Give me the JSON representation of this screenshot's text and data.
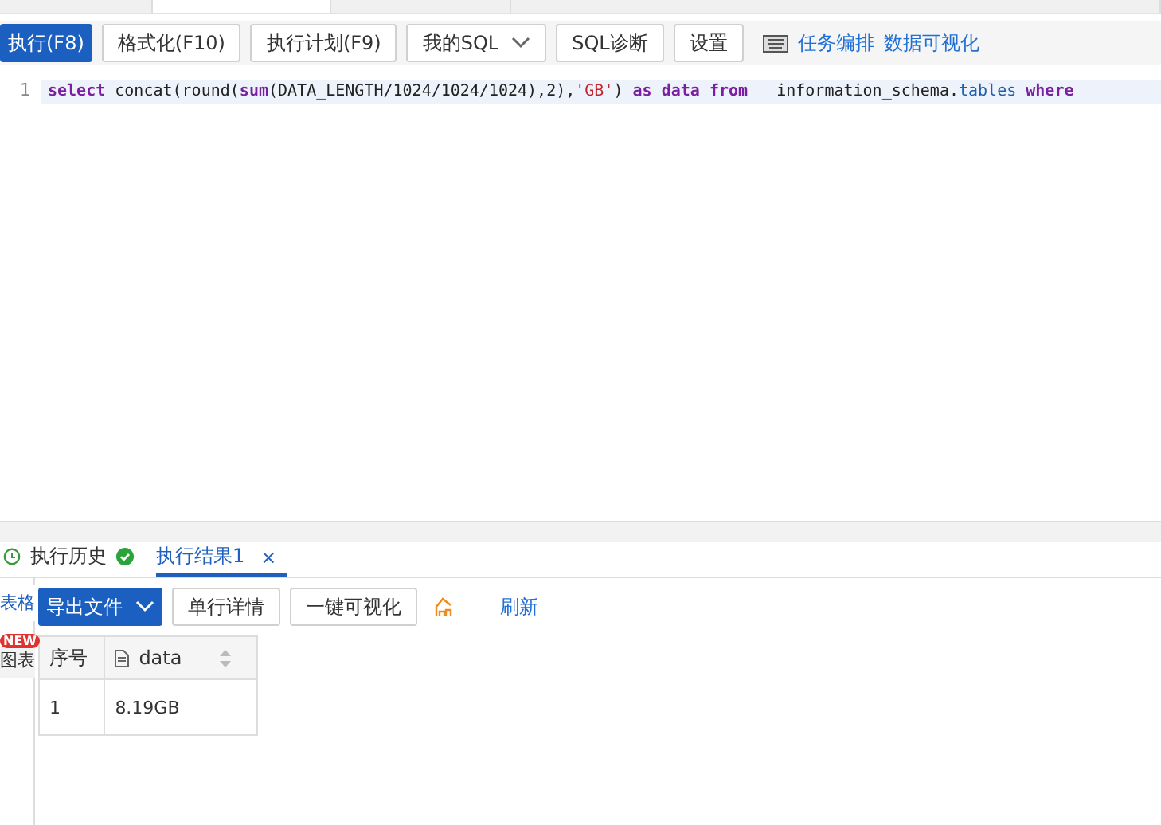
{
  "toolbar": {
    "buttons": [
      {
        "label": "执行(F8)",
        "kind": "primary"
      },
      {
        "label": "格式化(F10)",
        "kind": "plain"
      },
      {
        "label": "执行计划(F9)",
        "kind": "plain"
      },
      {
        "label": "我的SQL",
        "kind": "dropdown"
      },
      {
        "label": "SQL诊断",
        "kind": "plain"
      },
      {
        "label": "设置",
        "kind": "plain"
      }
    ],
    "links": [
      "任务编排",
      "数据可视化"
    ]
  },
  "editor": {
    "lines": [
      {
        "number": "1",
        "tokens": [
          {
            "text": "select",
            "kind": "keyword"
          },
          {
            "text": " concat(round(",
            "kind": "plain"
          },
          {
            "text": "sum",
            "kind": "keyword"
          },
          {
            "text": "(DATA_LENGTH/1024/1024/1024),2),",
            "kind": "plain"
          },
          {
            "text": "'GB'",
            "kind": "string"
          },
          {
            "text": ") ",
            "kind": "plain"
          },
          {
            "text": "as data from",
            "kind": "keyword"
          },
          {
            "text": "   information_schema.",
            "kind": "plain"
          },
          {
            "text": "tables",
            "kind": "property"
          },
          {
            "text": " where",
            "kind": "keyword"
          }
        ]
      }
    ]
  },
  "result_tabs": [
    {
      "label": "执行历史",
      "kind": "history",
      "selected": false
    },
    {
      "label": "执行结果1",
      "kind": "result",
      "selected": true,
      "closable": true,
      "close": "×"
    }
  ],
  "side_tabs": [
    {
      "label": "表格",
      "selected": true
    },
    {
      "label": "图表",
      "selected": false,
      "badge": "NEW"
    }
  ],
  "result_toolbar": {
    "buttons": [
      {
        "label": "导出文件",
        "kind": "primary"
      },
      {
        "label": "单行详情",
        "kind": "plain"
      },
      {
        "label": "一键可视化",
        "kind": "plain"
      }
    ],
    "link": "刷新"
  },
  "table": {
    "columns": [
      "序号",
      "data"
    ],
    "rows": [
      [
        "1",
        "8.19GB"
      ]
    ]
  }
}
